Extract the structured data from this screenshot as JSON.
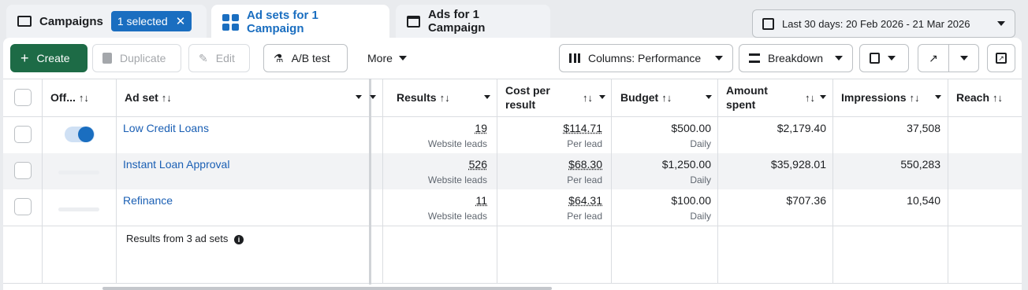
{
  "tabs": {
    "campaigns": {
      "label": "Campaigns",
      "selected_badge": "1 selected",
      "clear": "✕"
    },
    "adsets": {
      "label": "Ad sets for 1 Campaign"
    },
    "ads": {
      "label": "Ads for 1 Campaign"
    }
  },
  "date_range": {
    "label": "Last 30 days: 20 Feb 2026 - 21 Mar 2026"
  },
  "toolbar": {
    "create": "Create",
    "duplicate": "Duplicate",
    "edit": "Edit",
    "ab_test": "A/B test",
    "more": "More",
    "columns": "Columns: Performance",
    "breakdown": "Breakdown"
  },
  "table": {
    "headers": {
      "off_on": "Off...",
      "adset": "Ad set",
      "results": "Results",
      "cost_per_result_1": "Cost per",
      "cost_per_result_2": "result",
      "budget": "Budget",
      "amount_spent_1": "Amount",
      "amount_spent_2": "spent",
      "impressions": "Impressions",
      "reach": "Reach"
    },
    "rows": [
      {
        "name": "Low Credit Loans",
        "results": "19",
        "results_sub": "Website leads",
        "cost": "$114.71",
        "cost_sub": "Per lead",
        "budget": "$500.00",
        "budget_sub": "Daily",
        "spent": "$2,179.40",
        "impressions": "37,508",
        "toggle_on": true
      },
      {
        "name": "Instant Loan Approval",
        "results": "526",
        "results_sub": "Website leads",
        "cost": "$68.30",
        "cost_sub": "Per lead",
        "budget": "$1,250.00",
        "budget_sub": "Daily",
        "spent": "$35,928.01",
        "impressions": "550,283",
        "toggle_on": false
      },
      {
        "name": "Refinance",
        "results": "11",
        "results_sub": "Website leads",
        "cost": "$64.31",
        "cost_sub": "Per lead",
        "budget": "$100.00",
        "budget_sub": "Daily",
        "spent": "$707.36",
        "impressions": "10,540",
        "toggle_on": false
      }
    ],
    "footer": "Results from 3 ad sets"
  },
  "colors": {
    "accent": "#1a6ec0",
    "create": "#1d6b46",
    "link": "#1a5fb4"
  }
}
